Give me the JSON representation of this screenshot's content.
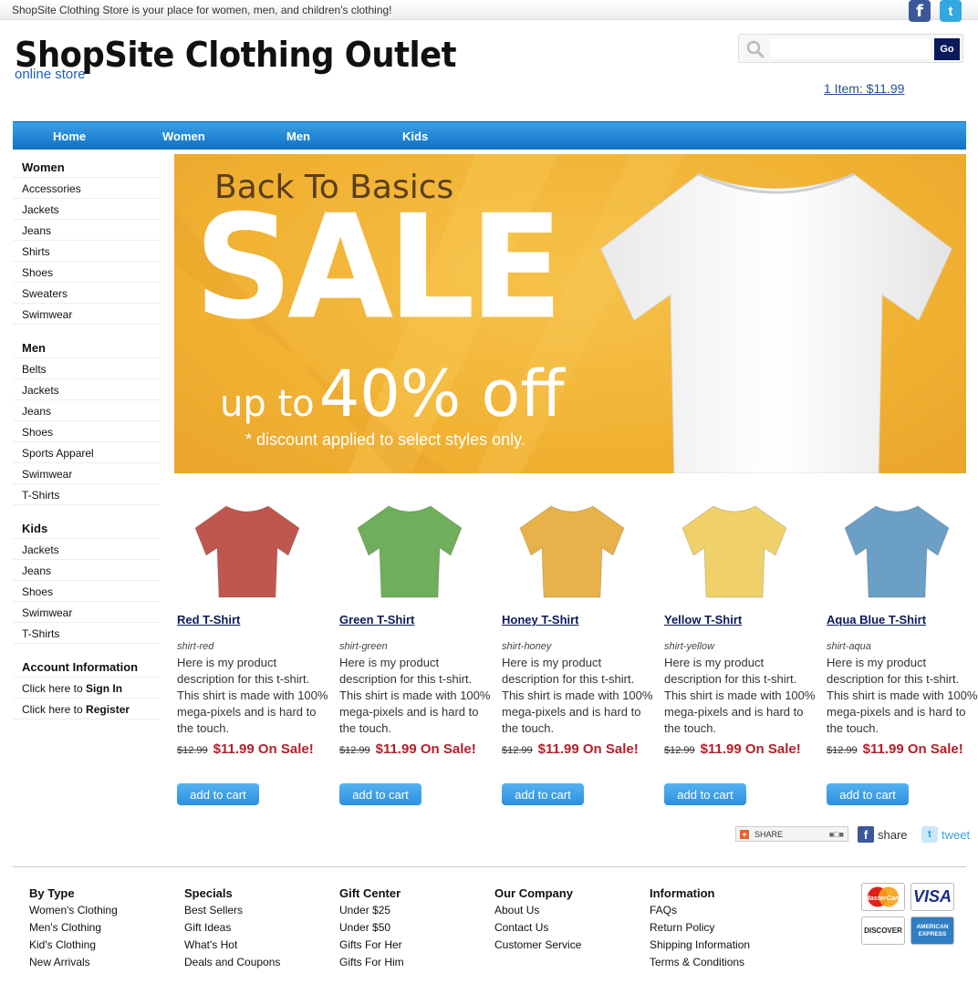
{
  "topbar": {
    "tagline": "ShopSite Clothing Store is your place for women, men, and children's clothing!"
  },
  "header": {
    "title": "ShopSite Clothing Outlet",
    "subtitle": "online store",
    "search_placeholder": "",
    "go_label": "Go",
    "cart": "1 Item: $11.99"
  },
  "nav": [
    "Home",
    "Women",
    "Men",
    "Kids"
  ],
  "sidebar": {
    "women": {
      "title": "Women",
      "items": [
        "Accessories",
        "Jackets",
        "Jeans",
        "Shirts",
        "Shoes",
        "Sweaters",
        "Swimwear"
      ]
    },
    "men": {
      "title": "Men",
      "items": [
        "Belts",
        "Jackets",
        "Jeans",
        "Shoes",
        "Sports Apparel",
        "Swimwear",
        "T-Shirts"
      ]
    },
    "kids": {
      "title": "Kids",
      "items": [
        "Jackets",
        "Jeans",
        "Shoes",
        "Swimwear",
        "T-Shirts"
      ]
    },
    "account": {
      "title": "Account Information",
      "signin_prefix": "Click here to ",
      "signin": "Sign In",
      "register_prefix": "Click here to ",
      "register": "Register"
    }
  },
  "banner": {
    "line1": "Back To Basics",
    "line2": "SALE",
    "line3a": "up to",
    "line3b": "40% off",
    "note": "* discount applied to select styles only."
  },
  "products": [
    {
      "name": "Red T-Shirt",
      "sku": "shirt-red",
      "color": "#c0574f",
      "desc": "Here is my product description for this t-shirt. This shirt is made with 100% mega-pixels and is hard to the touch.",
      "old": "$12.99",
      "sale": "$11.99 On Sale!",
      "button": "add to cart"
    },
    {
      "name": "Green T-Shirt",
      "sku": "shirt-green",
      "color": "#6fae5a",
      "desc": "Here is my product description for this t-shirt. This shirt is made with 100% mega-pixels and is hard to the touch.",
      "old": "$12.99",
      "sale": "$11.99 On Sale!",
      "button": "add to cart"
    },
    {
      "name": "Honey T-Shirt",
      "sku": "shirt-honey",
      "color": "#e8b24a",
      "desc": "Here is my product description for this t-shirt. This shirt is made with 100% mega-pixels and is hard to the touch.",
      "old": "$12.99",
      "sale": "$11.99 On Sale!",
      "button": "add to cart"
    },
    {
      "name": "Yellow T-Shirt",
      "sku": "shirt-yellow",
      "color": "#efd069",
      "desc": "Here is my product description for this t-shirt. This shirt is made with 100% mega-pixels and is hard to the touch.",
      "old": "$12.99",
      "sale": "$11.99 On Sale!",
      "button": "add to cart"
    },
    {
      "name": "Aqua Blue T-Shirt",
      "sku": "shirt-aqua",
      "color": "#6b9fc6",
      "desc": "Here is my product description for this t-shirt. This shirt is made with 100% mega-pixels and is hard to the touch.",
      "old": "$12.99",
      "sale": "$11.99 On Sale!",
      "button": "add to cart"
    }
  ],
  "share": {
    "share_label": "SHARE",
    "fb": "share",
    "tw": "tweet"
  },
  "footer": [
    {
      "title": "By Type",
      "links": [
        "Women's Clothing",
        "Men's Clothing",
        "Kid's Clothing",
        "New Arrivals"
      ]
    },
    {
      "title": "Specials",
      "links": [
        "Best Sellers",
        "Gift Ideas",
        "What's Hot",
        "Deals and Coupons"
      ]
    },
    {
      "title": "Gift Center",
      "links": [
        "Under $25",
        "Under $50",
        "Gifts For Her",
        "Gifts For Him"
      ]
    },
    {
      "title": "Our Company",
      "links": [
        "About Us",
        "Contact Us",
        "Customer Service"
      ]
    },
    {
      "title": "Information",
      "links": [
        "FAQs",
        "Return Policy",
        "Shipping Information",
        "Terms & Conditions"
      ]
    }
  ],
  "cards": [
    "MasterCard",
    "VISA",
    "DISCOVER",
    "AMERICAN EXPRESS"
  ],
  "colors": {
    "nav": "#1a7fd0",
    "banner": "#f1b233",
    "sale_red": "#b3202a",
    "link_navy": "#0b1a5a"
  }
}
